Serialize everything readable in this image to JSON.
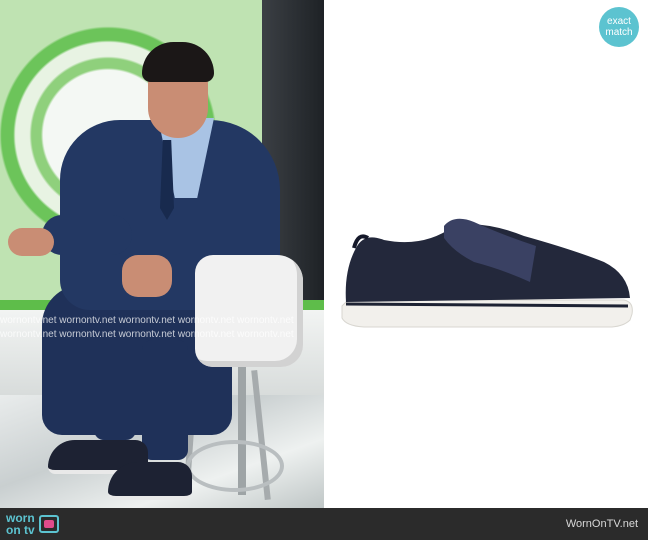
{
  "badge": {
    "line1": "exact",
    "line2": "match"
  },
  "watermark": {
    "text": "wornontv.net wornontv.net wornontv.net wornontv.net wornontv.net"
  },
  "logo": {
    "line1": "worn",
    "line2": "on tv"
  },
  "footer": {
    "site": "WornOnTV.net"
  },
  "product": {
    "name": "Navy slip-on sneaker",
    "brand_text": ""
  },
  "colors": {
    "accent": "#5cc3d0",
    "footer_bg": "#2b2b2b",
    "shoe": "#1d2233"
  }
}
